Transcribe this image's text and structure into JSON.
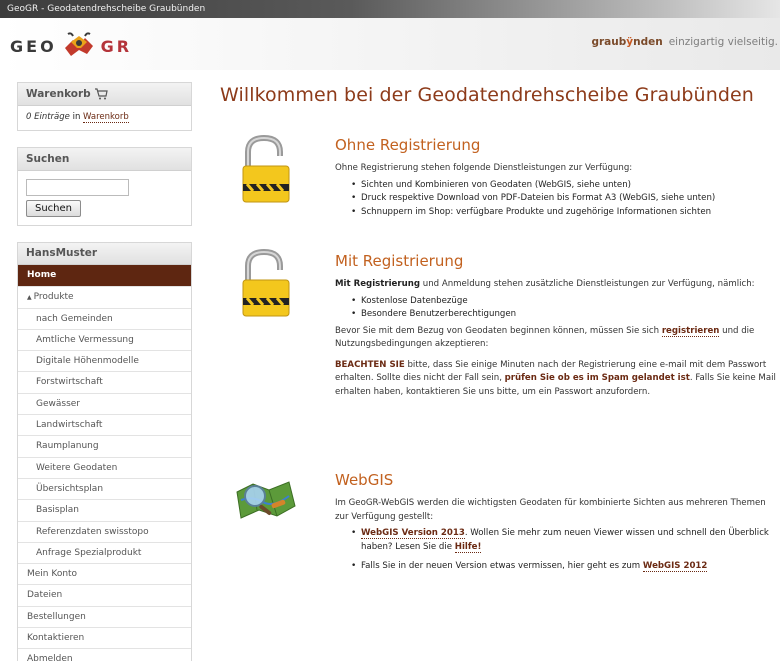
{
  "window": {
    "title": "GeoGR - Geodatendrehscheibe Graubünden"
  },
  "header": {
    "logo_left": "GEO",
    "logo_right": "GR",
    "brand_pre": "graub",
    "brand_mark": "ÿ",
    "brand_post": "nden",
    "brand_tagline": "einzigartig vielseitig."
  },
  "sidebar": {
    "cart": {
      "title": "Warenkorb",
      "count_text": "0 Einträge",
      "in_text": "in",
      "link": "Warenkorb"
    },
    "search": {
      "title": "Suchen",
      "input_value": "",
      "button": "Suchen"
    },
    "user": {
      "title": "HansMuster"
    },
    "menu": [
      {
        "label": "Home",
        "active": true,
        "level": 0
      },
      {
        "label": "Produkte",
        "level": 0,
        "expanded": true
      },
      {
        "label": "nach Gemeinden",
        "level": 1
      },
      {
        "label": "Amtliche Vermessung",
        "level": 1
      },
      {
        "label": "Digitale Höhenmodelle",
        "level": 1
      },
      {
        "label": "Forstwirtschaft",
        "level": 1
      },
      {
        "label": "Gewässer",
        "level": 1
      },
      {
        "label": "Landwirtschaft",
        "level": 1
      },
      {
        "label": "Raumplanung",
        "level": 1
      },
      {
        "label": "Weitere Geodaten",
        "level": 1
      },
      {
        "label": "Übersichtsplan",
        "level": 1
      },
      {
        "label": "Basisplan",
        "level": 1
      },
      {
        "label": "Referenzdaten swisstopo",
        "level": 1
      },
      {
        "label": "Anfrage Spezialprodukt",
        "level": 1
      },
      {
        "label": "Mein Konto",
        "level": 0
      },
      {
        "label": "Dateien",
        "level": 0
      },
      {
        "label": "Bestellungen",
        "level": 0
      },
      {
        "label": "Kontaktieren",
        "level": 0
      },
      {
        "label": "Abmelden",
        "level": 0
      }
    ]
  },
  "main": {
    "title": "Willkommen bei der Geodatendrehscheibe Graubünden",
    "ohne": {
      "heading": "Ohne Registrierung",
      "intro": "Ohne Registrierung stehen folgende Dienstleistungen zur Verfügung:",
      "items": [
        "Sichten und Kombinieren von Geodaten (WebGIS, siehe unten)",
        "Druck respektive Download von PDF-Dateien bis Format A3 (WebGIS, siehe unten)",
        "Schnuppern im Shop: verfügbare Produkte und zugehörige Informationen sichten"
      ]
    },
    "mit": {
      "heading": "Mit Registrierung",
      "intro_bold": "Mit Registrierung",
      "intro_rest": " und Anmeldung stehen zusätzliche Dienstleistungen zur Verfügung, nämlich:",
      "items": [
        "Kostenlose Datenbezüge",
        "Besondere Benutzerberechtigungen"
      ],
      "p2_a": "Bevor Sie mit dem Bezug von Geodaten beginnen können, müssen Sie sich ",
      "p2_link": "registrieren",
      "p2_b": " und die Nutzungsbedingungen akzeptieren:",
      "p3_bold": "BEACHTEN SIE",
      "p3_a": " bitte, dass Sie einige Minuten nach der Registrierung eine e-mail mit dem Passwort erhalten. Sollte dies nicht der Fall sein, ",
      "p3_bold2": "prüfen Sie ob es im Spam gelandet ist",
      "p3_b": ". Falls Sie keine Mail erhalten haben, kontaktieren Sie uns bitte, um ein Passwort anzufordern."
    },
    "webgis": {
      "heading": "WebGIS",
      "intro": "Im GeoGR-WebGIS werden die wichtigsten Geodaten für kombinierte Sichten aus mehreren Themen zur Verfügung gestellt:",
      "item1_link": "WebGIS Version 2013",
      "item1_a": ". Wollen Sie mehr zum neuen Viewer wissen und schnell den Überblick haben? Lesen Sie die ",
      "item1_link2": "Hilfe!",
      "item2_a": "Falls Sie in der neuen Version etwas vermissen, hier geht es zum ",
      "item2_link": "WebGIS 2012"
    }
  },
  "colors": {
    "accent": "#8d3b1a",
    "heading": "#c2611f",
    "active_menu": "#5e2611",
    "link": "#6b2a13"
  }
}
